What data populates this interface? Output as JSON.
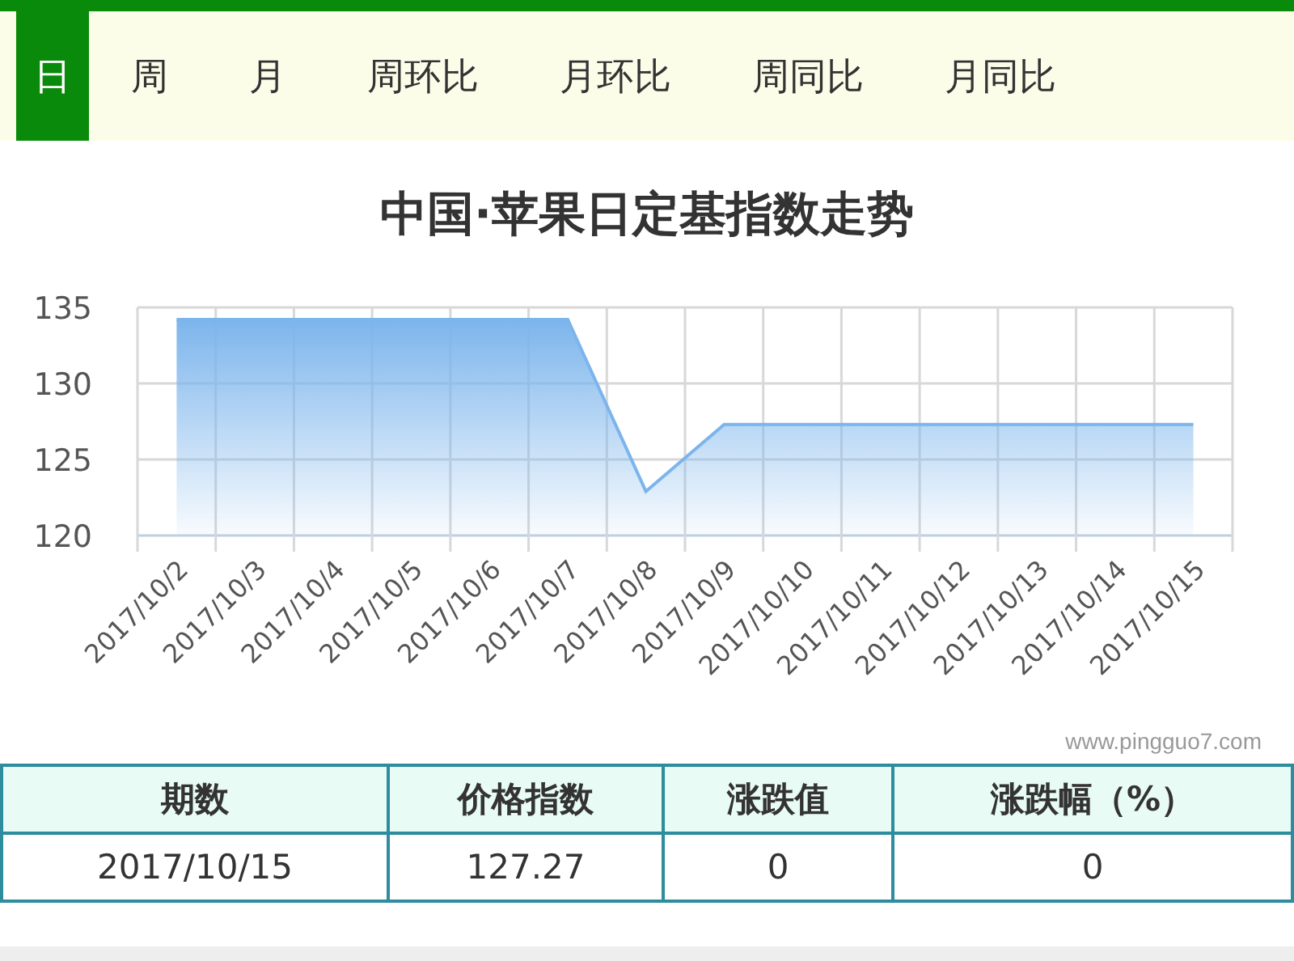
{
  "tabs": [
    {
      "label": "日",
      "selected": true
    },
    {
      "label": "周",
      "selected": false
    },
    {
      "label": "月",
      "selected": false
    },
    {
      "label": "周环比",
      "selected": false
    },
    {
      "label": "月环比",
      "selected": false
    },
    {
      "label": "周同比",
      "selected": false
    },
    {
      "label": "月同比",
      "selected": false
    }
  ],
  "chart": {
    "credits": "www.pingguo7.com",
    "chart_data": {
      "type": "area",
      "title": "中国·苹果日定基指数走势",
      "categories": [
        "2017/10/2",
        "2017/10/3",
        "2017/10/4",
        "2017/10/5",
        "2017/10/6",
        "2017/10/7",
        "2017/10/8",
        "2017/10/9",
        "2017/10/10",
        "2017/10/11",
        "2017/10/12",
        "2017/10/13",
        "2017/10/14",
        "2017/10/15"
      ],
      "series": [
        {
          "color": "#7cb5ec",
          "values": [
            134.2,
            134.2,
            134.2,
            134.2,
            134.2,
            134.2,
            122.9,
            127.3,
            127.3,
            127.3,
            127.3,
            127.3,
            127.3,
            127.3
          ]
        }
      ],
      "ylim": [
        120,
        135
      ],
      "yticks": [
        120,
        125,
        130,
        135
      ]
    }
  },
  "table": {
    "columns": [
      "期数",
      "价格指数",
      "涨跌值",
      "涨跌幅（%）"
    ],
    "rows": [
      [
        "2017/10/15",
        "127.27",
        "0",
        "0"
      ]
    ]
  }
}
